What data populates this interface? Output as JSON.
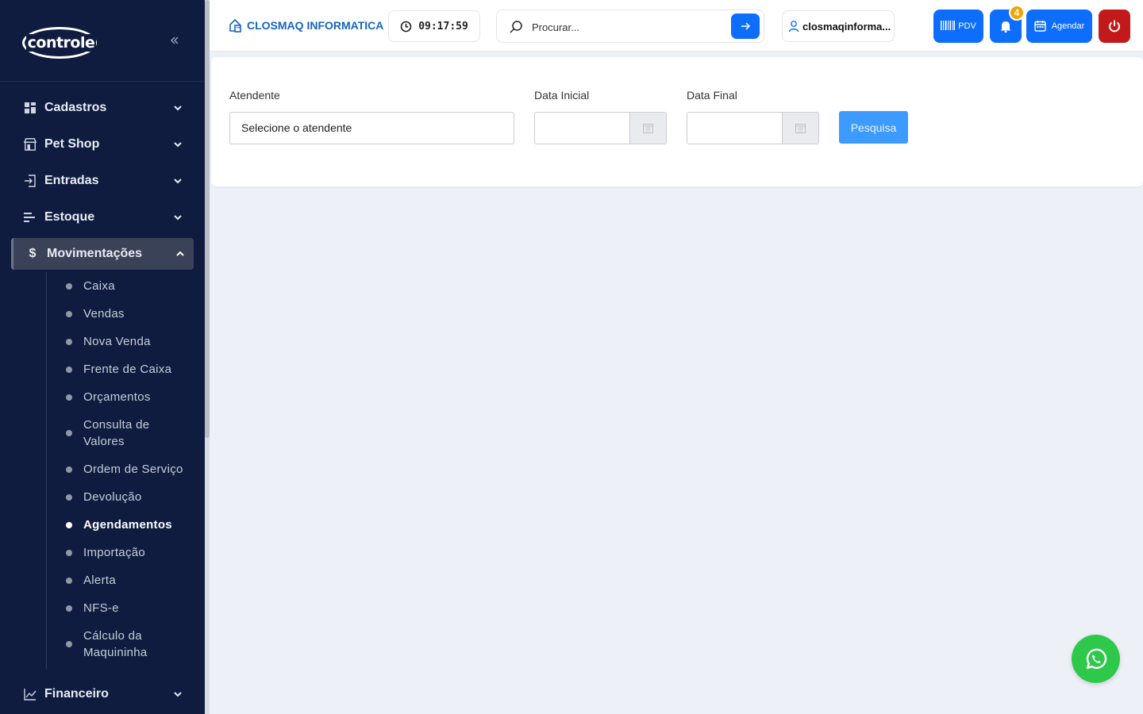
{
  "brand": {
    "logo_text": "controle"
  },
  "sidebar": {
    "collapse_icon": "double-chevron-left-icon",
    "items": [
      {
        "label": "Cadastros",
        "icon": "grid-icon"
      },
      {
        "label": "Pet Shop",
        "icon": "store-icon"
      },
      {
        "label": "Entradas",
        "icon": "login-icon"
      },
      {
        "label": "Estoque",
        "icon": "bars-icon"
      },
      {
        "label": "Movimentações",
        "icon": "dollar-icon"
      }
    ],
    "dollar_glyph": "$",
    "submenu": [
      {
        "label": "Caixa"
      },
      {
        "label": "Vendas"
      },
      {
        "label": "Nova Venda"
      },
      {
        "label": "Frente de Caixa"
      },
      {
        "label": "Orçamentos"
      },
      {
        "label": "Consulta de Valores"
      },
      {
        "label": "Ordem de Serviço"
      },
      {
        "label": "Devolução"
      },
      {
        "label": "Agendamentos"
      },
      {
        "label": "Importação"
      },
      {
        "label": "Alerta"
      },
      {
        "label": "NFS-e"
      },
      {
        "label": "Cálculo da Maquininha"
      }
    ],
    "bottom_item": {
      "label": "Financeiro",
      "icon": "chart-line-icon"
    }
  },
  "topbar": {
    "company": "CLOSMAQ INFORMATICA",
    "clock": "09:17:59",
    "search_placeholder": "Procurar...",
    "username": "closmaqinforma...",
    "pdv_label": "PDV",
    "notification_count": "4",
    "agendar_label": "Agendar"
  },
  "filters": {
    "attendant_label": "Atendente",
    "attendant_value": "Selecione o atendente",
    "start_date_label": "Data Inicial",
    "start_date_value": "",
    "end_date_label": "Data Final",
    "end_date_value": "",
    "search_button": "Pesquisa"
  },
  "colors": {
    "sidebar_bg": "#0f1c3f",
    "primary": "#0d6efd",
    "danger": "#c21a1a",
    "badge": "#f4a300",
    "whatsapp": "#2ec84a"
  }
}
